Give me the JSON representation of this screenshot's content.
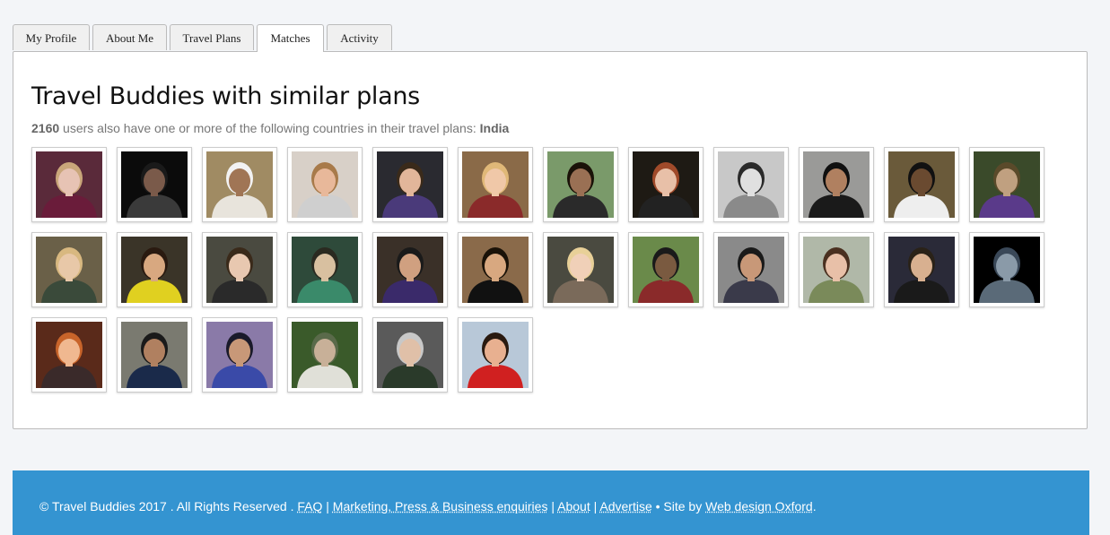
{
  "tabs": [
    {
      "label": "My Profile",
      "active": false
    },
    {
      "label": "About Me",
      "active": false
    },
    {
      "label": "Travel Plans",
      "active": false
    },
    {
      "label": "Matches",
      "active": true
    },
    {
      "label": "Activity",
      "active": false
    }
  ],
  "main": {
    "title": "Travel Buddies with similar plans",
    "user_count": "2160",
    "subtitle_text": "users also have one or more of the following countries in their travel plans:",
    "country": "India"
  },
  "profile_photos": [
    {
      "bg": "#5a2a3a",
      "skin": "#e7c3b4",
      "hair": "#c9a67a",
      "shirt": "#6a1c3a"
    },
    {
      "bg": "#0b0b0b",
      "skin": "#7a5a4a",
      "hair": "#1a1a1a",
      "shirt": "#3a3a3a"
    },
    {
      "bg": "#a08b63",
      "skin": "#a07555",
      "hair": "#f2f2f2",
      "shirt": "#e8e4dc"
    },
    {
      "bg": "#d8d0c8",
      "skin": "#e8b89a",
      "hair": "#a87a4a",
      "shirt": "#cfcfcf"
    },
    {
      "bg": "#2a2a30",
      "skin": "#e2b69a",
      "hair": "#3a2a1a",
      "shirt": "#4a3a7a"
    },
    {
      "bg": "#8a6a48",
      "skin": "#f0c8a8",
      "hair": "#e0b878",
      "shirt": "#8a2a2a"
    },
    {
      "bg": "#7a9a6a",
      "skin": "#9a7054",
      "hair": "#1a1208",
      "shirt": "#2a2a2a"
    },
    {
      "bg": "#1e1a14",
      "skin": "#e8c0a8",
      "hair": "#a04a2a",
      "shirt": "#222222"
    },
    {
      "bg": "#c8c8c8",
      "skin": "#e0e0e0",
      "hair": "#2a2a2a",
      "shirt": "#8a8a8a"
    },
    {
      "bg": "#9a9a98",
      "skin": "#b08060",
      "hair": "#101010",
      "shirt": "#1a1a1a"
    },
    {
      "bg": "#6a5a3a",
      "skin": "#6a4a30",
      "hair": "#111111",
      "shirt": "#eeeeee"
    },
    {
      "bg": "#3a4a2a",
      "skin": "#c0a080",
      "hair": "#5a4a2a",
      "shirt": "#5a3a8a"
    },
    {
      "bg": "#6a6048",
      "skin": "#e8c8a8",
      "hair": "#d8b880",
      "shirt": "#3a4a3a"
    },
    {
      "bg": "#3a3428",
      "skin": "#d8a880",
      "hair": "#2a1a10",
      "shirt": "#e0d020"
    },
    {
      "bg": "#4a4a40",
      "skin": "#e8c8b0",
      "hair": "#3a2a1a",
      "shirt": "#2a2a2a"
    },
    {
      "bg": "#2e4a3a",
      "skin": "#d8c0a0",
      "hair": "#2a2a20",
      "shirt": "#3a8a6a"
    },
    {
      "bg": "#3a3028",
      "skin": "#d0a080",
      "hair": "#1a1a1a",
      "shirt": "#3a2a6a"
    },
    {
      "bg": "#8a6a4a",
      "skin": "#d8a880",
      "hair": "#1a1208",
      "shirt": "#111111"
    },
    {
      "bg": "#4a4a40",
      "skin": "#f0d0b8",
      "hair": "#e8d098",
      "shirt": "#7a6a5a"
    },
    {
      "bg": "#6a8a4a",
      "skin": "#7a5a40",
      "hair": "#1a1a1a",
      "shirt": "#8a2a2a"
    },
    {
      "bg": "#8a8a8a",
      "skin": "#c89878",
      "hair": "#1a1a1a",
      "shirt": "#3a3a4a"
    },
    {
      "bg": "#b0b8a8",
      "skin": "#e8c0a8",
      "hair": "#4a3020",
      "shirt": "#7a8a5a"
    },
    {
      "bg": "#2a2a38",
      "skin": "#d8b090",
      "hair": "#2a2218",
      "shirt": "#1a1a1a"
    },
    {
      "bg": "#000000",
      "skin": "#8a9aa8",
      "hair": "#3a4858",
      "shirt": "#5a6a78"
    },
    {
      "bg": "#5a2a1a",
      "skin": "#f0b890",
      "hair": "#c8642a",
      "shirt": "#3a2a2a"
    },
    {
      "bg": "#7a7a70",
      "skin": "#b08060",
      "hair": "#1a1a1a",
      "shirt": "#1a2a4a"
    },
    {
      "bg": "#8a7aa8",
      "skin": "#c89878",
      "hair": "#1a1a2a",
      "shirt": "#3a4aa8"
    },
    {
      "bg": "#3a5a2a",
      "skin": "#c8b098",
      "hair": "#5a6a4a",
      "shirt": "#e0e0d8"
    },
    {
      "bg": "#5a5a5a",
      "skin": "#e0c0a8",
      "hair": "#c8c8c8",
      "shirt": "#2a3a2a"
    },
    {
      "bg": "#b8c8d8",
      "skin": "#e8b090",
      "hair": "#2a1a10",
      "shirt": "#d02020"
    }
  ],
  "footer": {
    "copyright": "© Travel Buddies 2017 . All Rights Reserved . ",
    "faq": "FAQ",
    "sep1": " | ",
    "marketing": "Marketing, Press & Business enquiries",
    "sep2": " | ",
    "about": "About",
    "sep3": " | ",
    "advertise": "Advertise",
    "site_by": " • Site by ",
    "designer": "Web design Oxford",
    "end": "."
  }
}
